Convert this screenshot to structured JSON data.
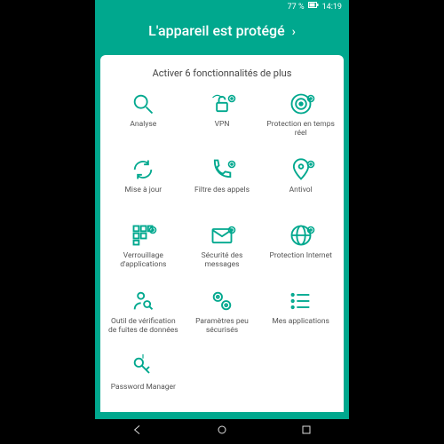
{
  "status": {
    "battery": "77 %",
    "time": "14:19"
  },
  "header": {
    "title": "L'appareil est protégé"
  },
  "subtitle": "Activer 6 fonctionnalités de plus",
  "tiles": [
    {
      "label": "Analyse"
    },
    {
      "label": "VPN"
    },
    {
      "label": "Protection en temps réel"
    },
    {
      "label": "Mise à jour"
    },
    {
      "label": "Filtre des appels"
    },
    {
      "label": "Antivol"
    },
    {
      "label": "Verrouillage d'applications"
    },
    {
      "label": "Sécurité des messages"
    },
    {
      "label": "Protection Internet"
    },
    {
      "label": "Outil de vérification de fuites de données"
    },
    {
      "label": "Paramètres peu sécurisés"
    },
    {
      "label": "Mes applications"
    },
    {
      "label": "Password Manager"
    }
  ],
  "colors": {
    "accent": "#00a88e"
  }
}
